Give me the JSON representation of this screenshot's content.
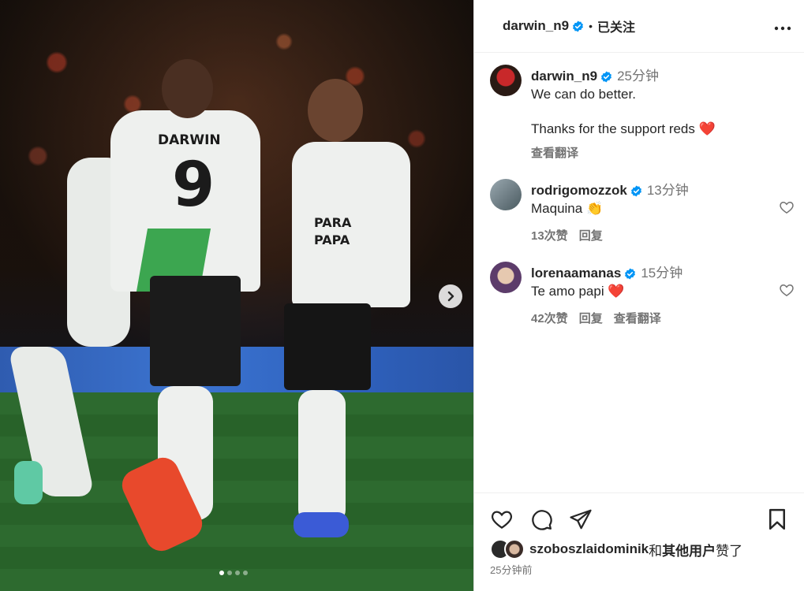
{
  "media": {
    "player_name": "DARWIN",
    "player_number": "9",
    "shirt_text": "PARA\nPAPA",
    "next_icon": "chevron-right-icon",
    "carousel_total": 4,
    "carousel_active": 1
  },
  "header": {
    "username": "darwin_n9",
    "separator": "•",
    "follow_status": "已关注",
    "more_icon": "more-horizontal-icon"
  },
  "caption": {
    "username": "darwin_n9",
    "time": "25分钟",
    "line1": "We can do better.",
    "line2": "Thanks for the support reds",
    "emoji": "❤️",
    "translate": "查看翻译"
  },
  "comments": [
    {
      "username": "rodrigomozzok",
      "time": "13分钟",
      "text": "Maquina",
      "emoji": "👏",
      "likes": "13次赞",
      "reply": "回复"
    },
    {
      "username": "lorenaamanas",
      "time": "15分钟",
      "text": "Te amo papi",
      "emoji": "❤️",
      "likes": "42次赞",
      "reply": "回复",
      "translate": "查看翻译"
    }
  ],
  "footer": {
    "liked_by_user": "szoboszlaidominik",
    "and": "和",
    "others": "其他用户",
    "liked": "赞了",
    "time": "25分钟前"
  },
  "colors": {
    "verified": "#0095f6",
    "heart": "#ff3040",
    "muted": "#737373"
  }
}
